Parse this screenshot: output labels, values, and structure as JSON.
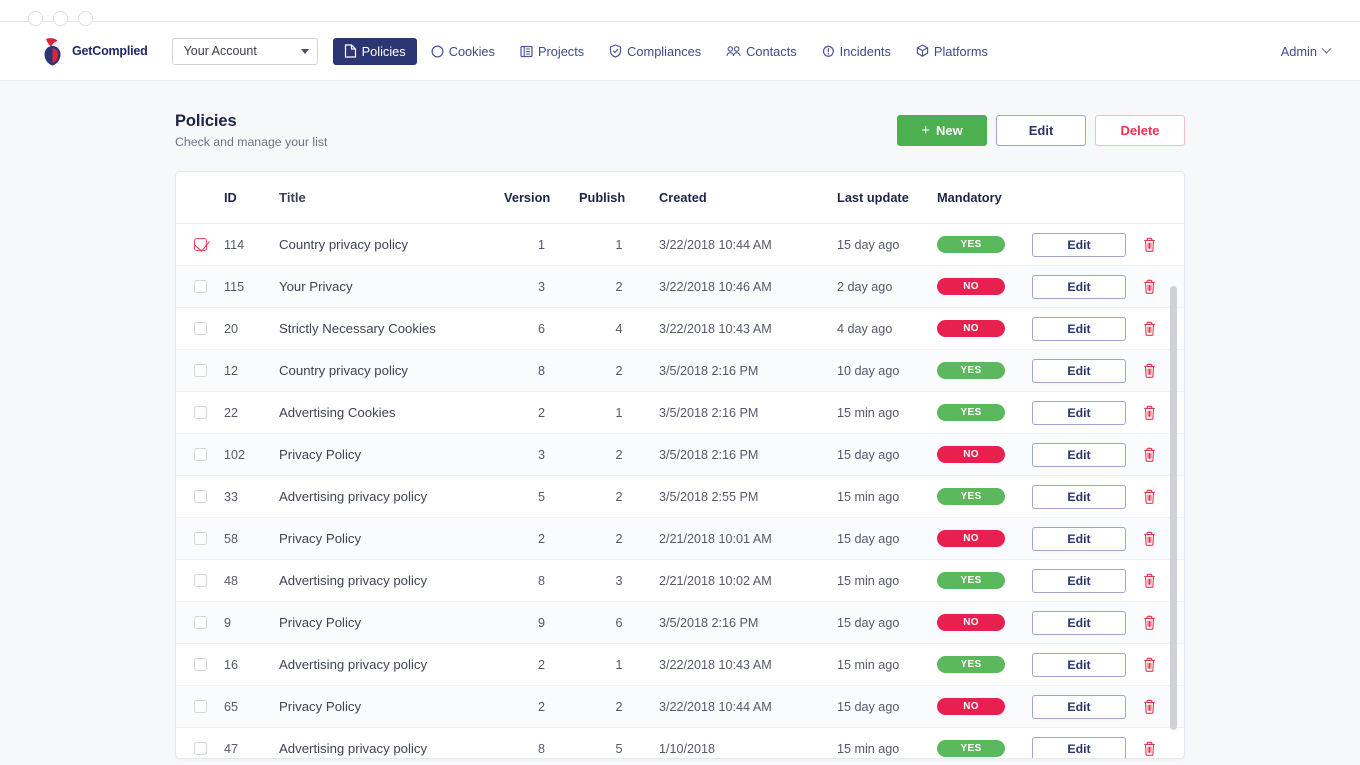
{
  "browser": {
    "window_dots": 3
  },
  "navbar": {
    "brand": "GetComplied",
    "account_select": {
      "value": "Your Account",
      "icon": "chevron-down-icon"
    },
    "links": [
      {
        "label": "Policies",
        "icon": "document-icon",
        "active": true
      },
      {
        "label": "Cookies",
        "icon": "circle-icon",
        "active": false
      },
      {
        "label": "Projects",
        "icon": "list-icon",
        "active": false
      },
      {
        "label": "Compliances",
        "icon": "shield-check-icon",
        "active": false
      },
      {
        "label": "Contacts",
        "icon": "contacts-icon",
        "active": false
      },
      {
        "label": "Incidents",
        "icon": "alert-circle-icon",
        "active": false
      },
      {
        "label": "Platforms",
        "icon": "cube-icon",
        "active": false
      }
    ],
    "user_menu": {
      "label": "Admin",
      "icon": "chevron-down-icon"
    }
  },
  "page": {
    "title": "Policies",
    "subtitle": "Check and manage your list",
    "buttons": {
      "new": "New",
      "new_plus": "+",
      "edit": "Edit",
      "delete": "Delete"
    }
  },
  "table": {
    "columns": [
      "ID",
      "Title",
      "Version",
      "Publish",
      "Created",
      "Last update",
      "Mandatory"
    ],
    "row_edit_label": "Edit",
    "delete_icon": "trash-icon",
    "rows": [
      {
        "checked": true,
        "id": "114",
        "title": "Country privacy policy",
        "version": "1",
        "publish": "1",
        "created": "3/22/2018 10:44 AM",
        "last_update": "15 day ago",
        "mandatory": "YES"
      },
      {
        "checked": false,
        "id": "115",
        "title": "Your Privacy",
        "version": "3",
        "publish": "2",
        "created": "3/22/2018 10:46 AM",
        "last_update": "2 day ago",
        "mandatory": "NO"
      },
      {
        "checked": false,
        "id": "20",
        "title": "Strictly Necessary Cookies",
        "version": "6",
        "publish": "4",
        "created": "3/22/2018 10:43 AM",
        "last_update": "4 day ago",
        "mandatory": "NO"
      },
      {
        "checked": false,
        "id": "12",
        "title": "Country privacy policy",
        "version": "8",
        "publish": "2",
        "created": "3/5/2018 2:16 PM",
        "last_update": "10 day ago",
        "mandatory": "YES"
      },
      {
        "checked": false,
        "id": "22",
        "title": "Advertising Cookies",
        "version": "2",
        "publish": "1",
        "created": "3/5/2018 2:16 PM",
        "last_update": "15 min ago",
        "mandatory": "YES"
      },
      {
        "checked": false,
        "id": "102",
        "title": "Privacy Policy",
        "version": "3",
        "publish": "2",
        "created": "3/5/2018 2:16 PM",
        "last_update": "15 day ago",
        "mandatory": "NO"
      },
      {
        "checked": false,
        "id": "33",
        "title": "Advertising privacy policy",
        "version": "5",
        "publish": "2",
        "created": "3/5/2018 2:55 PM",
        "last_update": "15 min ago",
        "mandatory": "YES"
      },
      {
        "checked": false,
        "id": "58",
        "title": "Privacy Policy",
        "version": "2",
        "publish": "2",
        "created": "2/21/2018 10:01 AM",
        "last_update": "15 day ago",
        "mandatory": "NO"
      },
      {
        "checked": false,
        "id": "48",
        "title": "Advertising privacy policy",
        "version": "8",
        "publish": "3",
        "created": "2/21/2018 10:02 AM",
        "last_update": "15 min ago",
        "mandatory": "YES"
      },
      {
        "checked": false,
        "id": "9",
        "title": "Privacy Policy",
        "version": "9",
        "publish": "6",
        "created": "3/5/2018 2:16 PM",
        "last_update": "15 day ago",
        "mandatory": "NO"
      },
      {
        "checked": false,
        "id": "16",
        "title": "Advertising privacy policy",
        "version": "2",
        "publish": "1",
        "created": "3/22/2018 10:43 AM",
        "last_update": "15 min ago",
        "mandatory": "YES"
      },
      {
        "checked": false,
        "id": "65",
        "title": "Privacy Policy",
        "version": "2",
        "publish": "2",
        "created": "3/22/2018 10:44 AM",
        "last_update": "15 day ago",
        "mandatory": "NO"
      },
      {
        "checked": false,
        "id": "47",
        "title": "Advertising privacy policy",
        "version": "8",
        "publish": "5",
        "created": "1/10/2018",
        "last_update": "15 min ago",
        "mandatory": "YES"
      }
    ]
  },
  "colors": {
    "nav_active_bg": "#2b3572",
    "nav_link": "#3f4a8a",
    "green": "#4caf50",
    "badge_yes": "#5cb85c",
    "badge_no": "#e8204f",
    "delete_red": "#f0314f",
    "page_bg": "#f7f8fa"
  }
}
